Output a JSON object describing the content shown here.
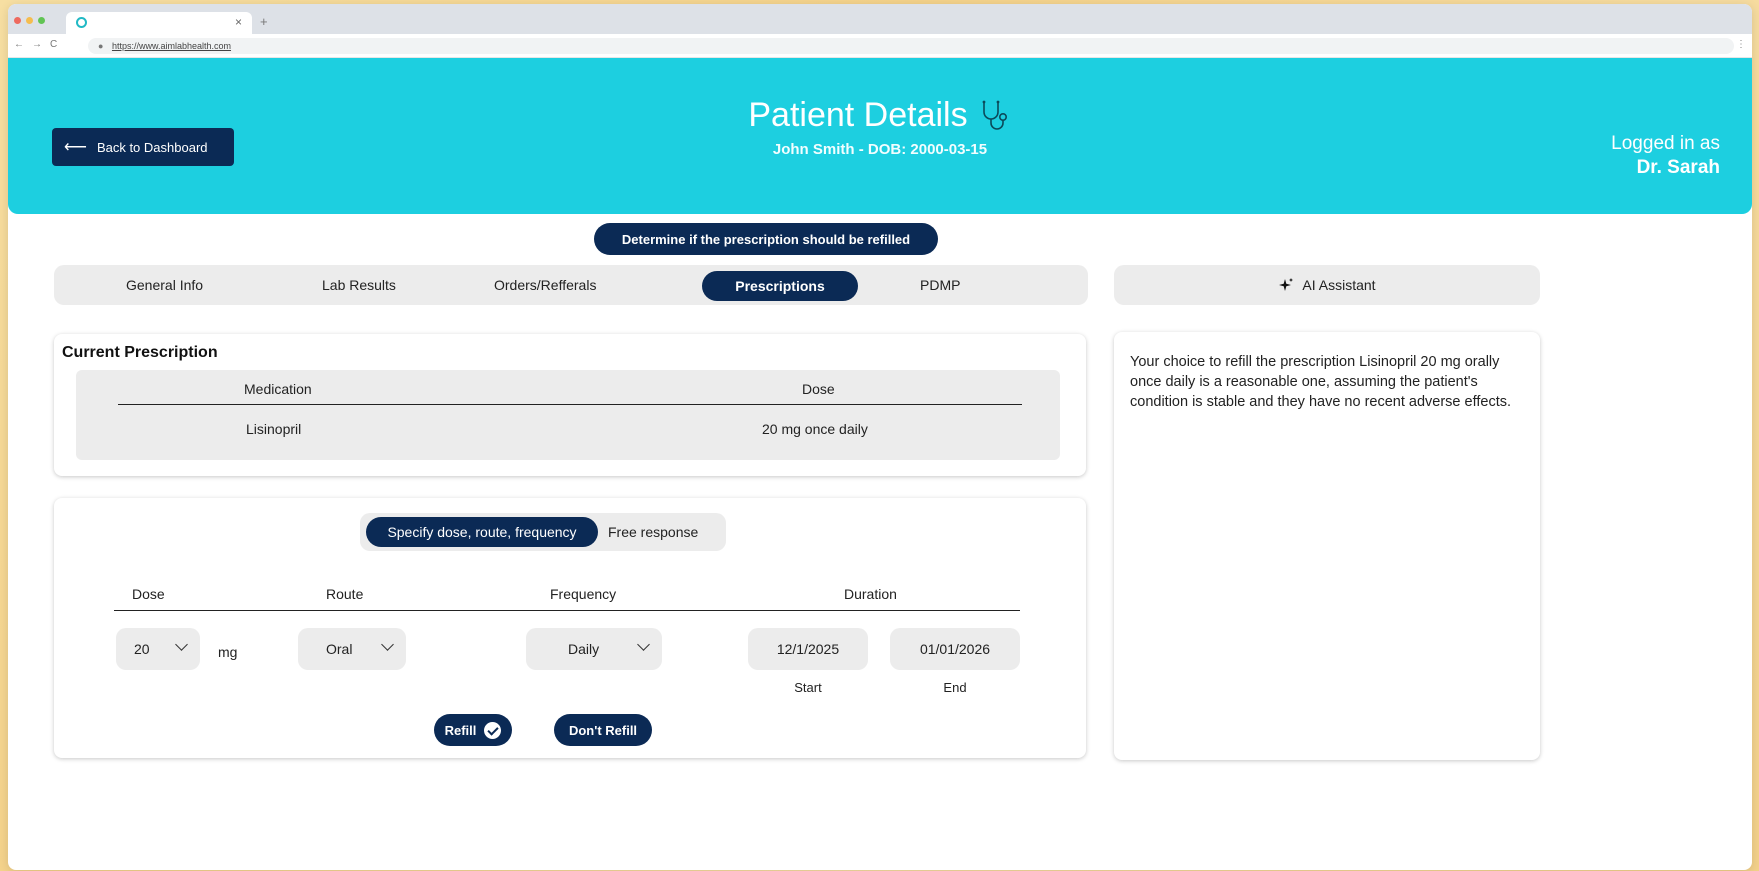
{
  "browser": {
    "url": "https://www.aimlabhealth.com",
    "close_glyph": "×",
    "new_tab_glyph": "+",
    "nav": [
      "←",
      "→",
      "C"
    ]
  },
  "header": {
    "back_label": "Back to Dashboard",
    "title": "Patient Details",
    "subtitle": "John Smith - DOB: 2000-03-15",
    "logged_in_label": "Logged in as",
    "user_name": "Dr. Sarah",
    "color": "#1dcfe0"
  },
  "task": "Determine if the prescription should be refilled",
  "tabs": [
    {
      "label": "General Info",
      "active": false
    },
    {
      "label": "Lab Results",
      "active": false
    },
    {
      "label": "Orders/Refferals",
      "active": false
    },
    {
      "label": "Prescriptions",
      "active": true
    },
    {
      "label": "PDMP",
      "active": false
    }
  ],
  "ai_tab_label": "AI Assistant",
  "current_prescription": {
    "title": "Current Prescription",
    "columns": [
      "Medication",
      "Dose"
    ],
    "rows": [
      [
        "Lisinopril",
        "20 mg once daily"
      ]
    ]
  },
  "refill_form": {
    "mode_options": [
      "Specify dose, route, frequency",
      "Free response"
    ],
    "active_mode": "Specify dose, route, frequency",
    "headers": {
      "dose": "Dose",
      "route": "Route",
      "frequency": "Frequency",
      "duration": "Duration"
    },
    "dose_value": "20",
    "dose_unit": "mg",
    "route_value": "Oral",
    "frequency_value": "Daily",
    "start_date": "12/1/2025",
    "end_date": "01/01/2026",
    "start_label": "Start",
    "end_label": "End",
    "refill_label": "Refill",
    "dont_refill_label": "Don't Refill"
  },
  "ai_response": "Your choice to refill the prescription Lisinopril 20 mg orally once daily is a reasonable one, assuming the patient's condition is stable and they have no recent adverse effects.",
  "colors": {
    "navy": "#0b2a55",
    "accent": "#1dcfe0",
    "panel": "#ececec"
  }
}
